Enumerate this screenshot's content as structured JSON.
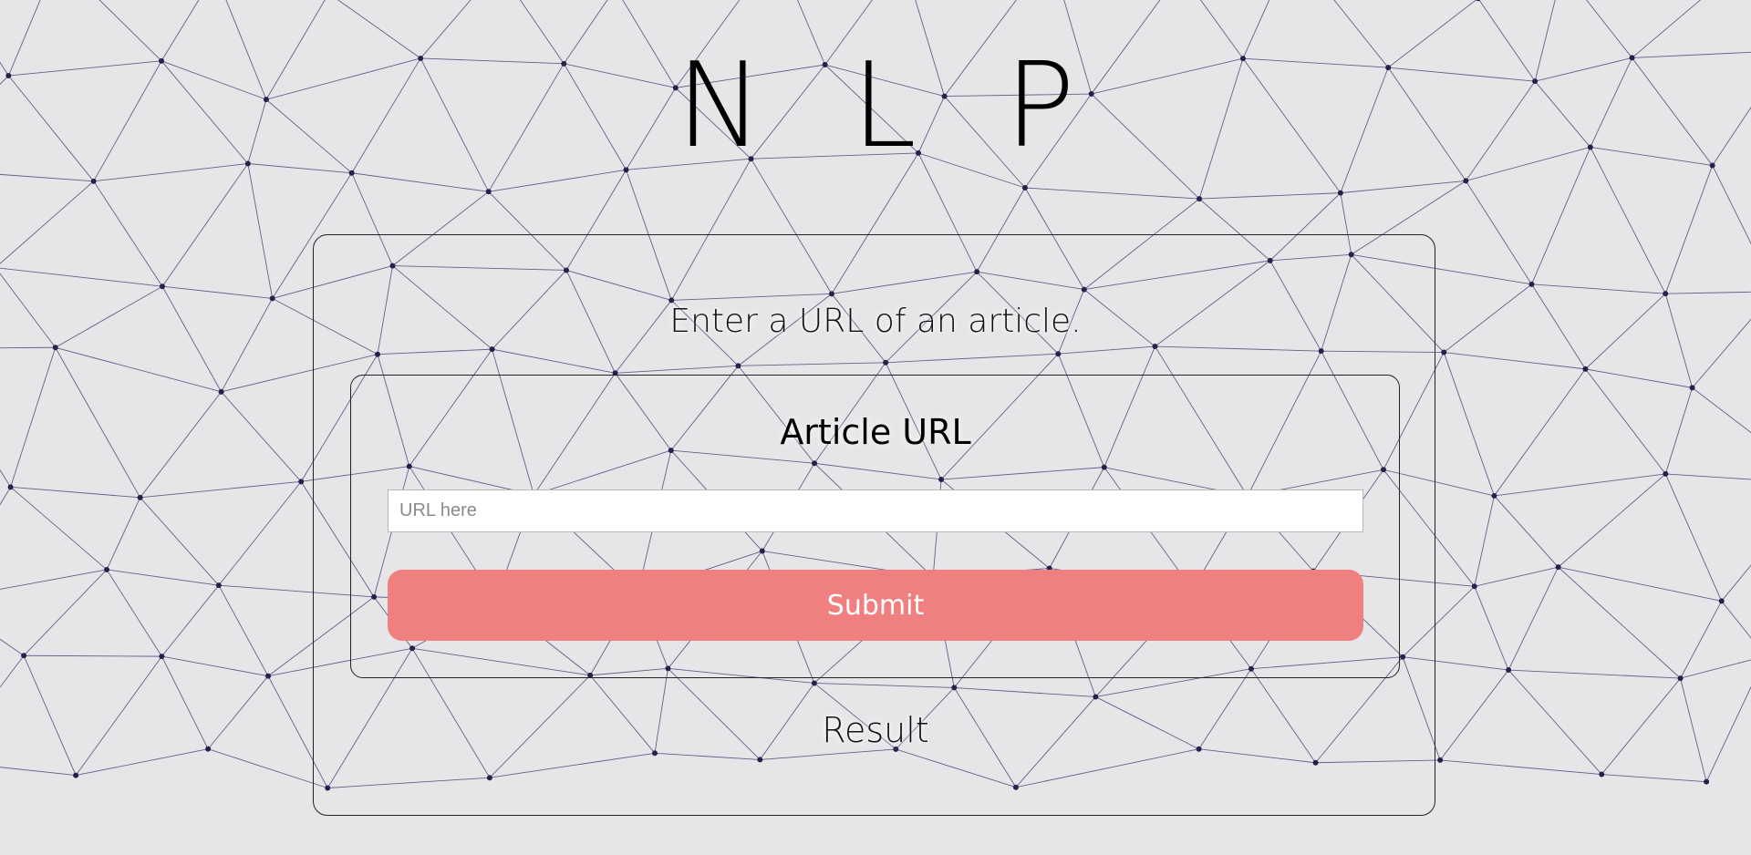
{
  "header": {
    "title": "N L P"
  },
  "form": {
    "prompt": "Enter a URL of an article.",
    "field_label": "Article URL",
    "url_input": {
      "value": "",
      "placeholder": "URL here"
    },
    "submit_label": "Submit"
  },
  "result": {
    "label": "Result"
  },
  "colors": {
    "background": "#e6e6e8",
    "submit_button": "#f07f7f",
    "network_lines": "#4a4a7a"
  }
}
